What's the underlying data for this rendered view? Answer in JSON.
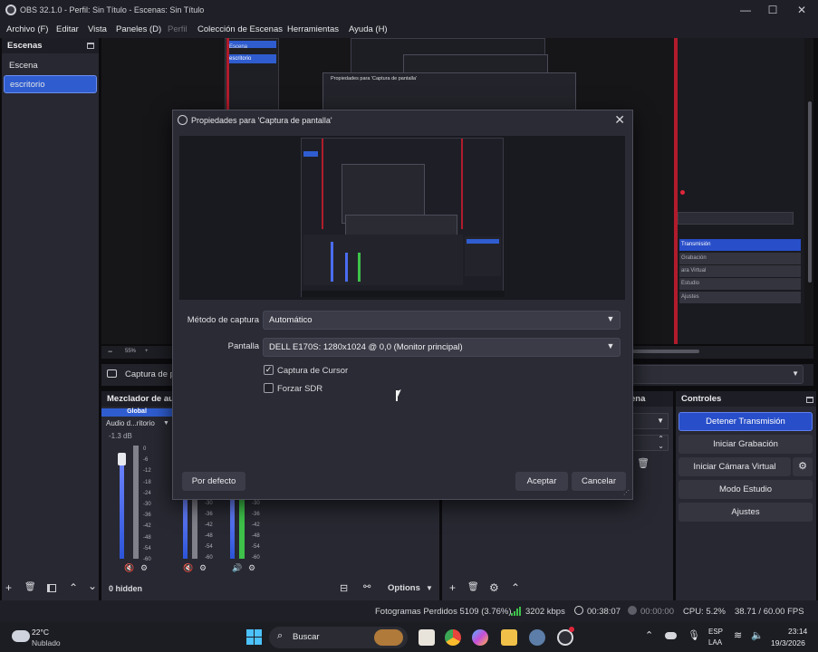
{
  "window": {
    "title": "OBS 32.1.0 - Perfil: Sin Título - Escenas: Sin Título",
    "controls": [
      "—",
      "☐",
      "✕"
    ]
  },
  "menu": [
    "Archivo (F)",
    "Editar",
    "Vista",
    "Paneles (D)",
    "Perfil",
    "Colección de Escenas",
    "Herramientas",
    "Ayuda (H)"
  ],
  "scenes": {
    "header": "Escenas",
    "items": [
      "Escena",
      "escritorio"
    ],
    "selected": "escritorio"
  },
  "preview_bottom": {
    "zoom": "55%",
    "source_label": "Captura de p"
  },
  "mixer": {
    "header": "Mezclador de au",
    "global_label": "Global",
    "channel_name": "Audio d...ritorio",
    "channel_db": "-1.3 dB",
    "scale": [
      "0",
      "-6",
      "-12",
      "-18",
      "-24",
      "-30",
      "-36",
      "-42",
      "-48",
      "-54",
      "-60"
    ],
    "scale_short": [
      "-30",
      "-36",
      "-42",
      "-48",
      "-54",
      "-60"
    ],
    "hidden_label": "0 hidden",
    "options_label": "Options"
  },
  "transitions": {
    "header": "ena"
  },
  "controls_dock": {
    "header": "Controles",
    "stream": "Detener Transmisión",
    "record": "Iniciar Grabación",
    "virtual_cam": "Iniciar Cámara Virtual",
    "studio": "Modo Estudio",
    "settings": "Ajustes"
  },
  "preview_recursion": {
    "small_title": "Propiedades para 'Captura de pantalla'",
    "side_items": [
      "Transmisión",
      "Grabación",
      "ara Virtual",
      "Estudio",
      "Ajustes"
    ],
    "inner_items": [
      "Escena",
      "escritorio"
    ]
  },
  "dialog": {
    "title": "Propiedades para 'Captura de pantalla'",
    "capture_method_label": "Método de captura",
    "capture_method_value": "Automático",
    "screen_label": "Pantalla",
    "screen_value": "DELL E170S: 1280x1024 @ 0,0 (Monitor principal)",
    "cursor_label": "Captura de Cursor",
    "cursor_checked": true,
    "sdr_label": "Forzar SDR",
    "sdr_checked": false,
    "defaults_button": "Por defecto",
    "accept_button": "Aceptar",
    "cancel_button": "Cancelar"
  },
  "status": {
    "dropped": "Fotogramas Perdidos 5109 (3.76%)",
    "bitrate": "3202 kbps",
    "stream_time": "00:38:07",
    "record_time": "00:00:00",
    "cpu": "CPU: 5.2%",
    "fps": "38.71 / 60.00 FPS"
  },
  "taskbar": {
    "temp": "22°C",
    "weather": "Nublado",
    "search": "Buscar",
    "lang_top": "ESP",
    "lang_bottom": "LAA",
    "time": "23:14",
    "date": "19/3/2026"
  },
  "colors": {
    "accent_blue": "#2f5dd0",
    "meter_green": "#3ec24a",
    "mute_red": "#e0263a"
  }
}
